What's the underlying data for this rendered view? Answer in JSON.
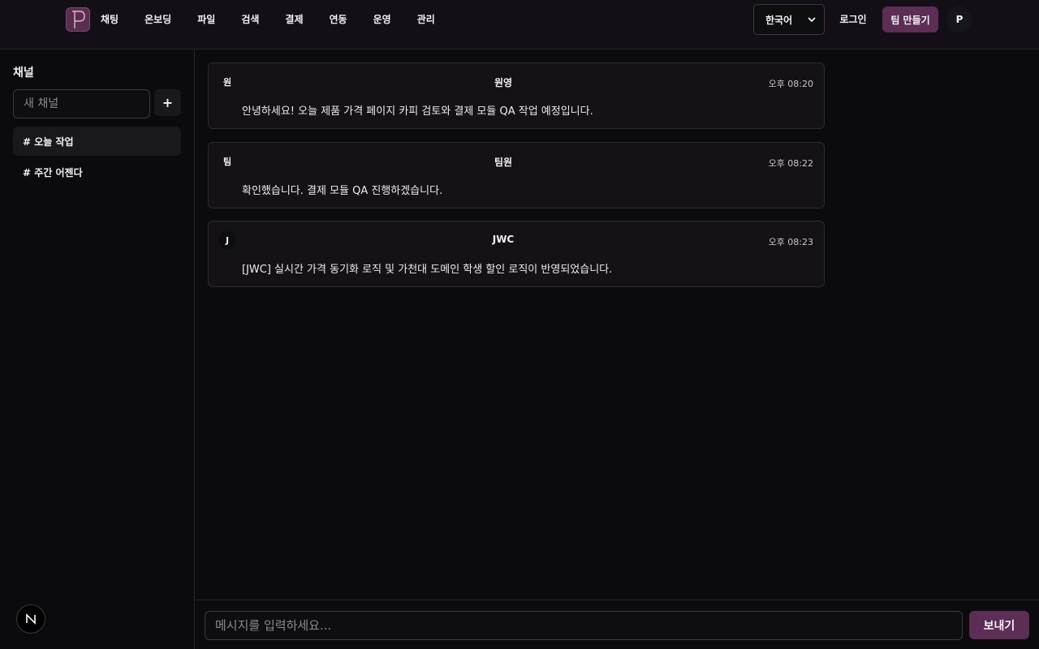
{
  "header": {
    "logo_letter": "P",
    "nav": [
      "채팅",
      "온보딩",
      "파일",
      "검색",
      "결제",
      "연동",
      "운영",
      "관리"
    ],
    "language": "한국어",
    "login_label": "로그인",
    "team_button_label": "팀 만들기",
    "avatar_letter": "P"
  },
  "sidebar": {
    "title": "채널",
    "new_channel_placeholder": "새 채널",
    "add_label": "+",
    "channels": [
      {
        "label": "# 오늘 작업",
        "active": true
      },
      {
        "label": "# 주간 어젠다",
        "active": false
      }
    ],
    "badge_letter": "N"
  },
  "messages": [
    {
      "initial": "원",
      "author": "원영",
      "time": "오후 08:20",
      "text": "안녕하세요! 오늘 제품 가격 페이지 카피 검토와 결제 모듈 QA 작업 예정입니다."
    },
    {
      "initial": "팀",
      "author": "팀원",
      "time": "오후 08:22",
      "text": "확인했습니다. 결제 모듈 QA 진행하겠습니다."
    },
    {
      "initial": "J",
      "author": "JWC",
      "time": "오후 08:23",
      "text": "[JWC] 실시간 가격 동기화 로직 및 가천대 도메인 학생 할인 로직이 반영되었습니다."
    }
  ],
  "composer": {
    "placeholder": "메시지를 입력하세요...",
    "send_label": "보내기"
  },
  "colors": {
    "accent": "#5c2d55",
    "background": "#0b0b0d",
    "topbar": "#140f16"
  }
}
